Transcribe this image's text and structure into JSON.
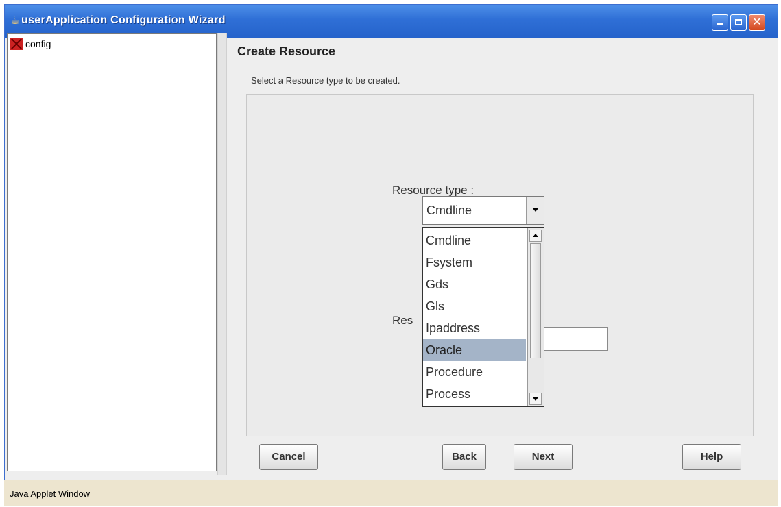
{
  "window": {
    "title": "userApplication Configuration Wizard",
    "title_icon": "java-cup-icon",
    "controls": [
      "minimize",
      "maximize",
      "close"
    ]
  },
  "tree": {
    "root": {
      "label": "config",
      "icon": "error-x-icon"
    }
  },
  "main": {
    "title": "Create Resource",
    "subtitle": "Select a Resource type to be created.",
    "resource_type_label": "Resource type   :",
    "resource_name_label_visible": "Res",
    "combo": {
      "selected": "Cmdline",
      "options": [
        "Cmdline",
        "Fsystem",
        "Gds",
        "Gls",
        "Ipaddress",
        "Oracle",
        "Procedure",
        "Process"
      ],
      "highlighted": "Oracle"
    }
  },
  "buttons": {
    "cancel": "Cancel",
    "back": "Back",
    "next": "Next",
    "help": "Help"
  },
  "status": {
    "text": "Java Applet Window"
  },
  "colors": {
    "titlebar": "#2f6fd6",
    "selection": "#a4b4c8",
    "statusbar": "#ede5cf"
  }
}
